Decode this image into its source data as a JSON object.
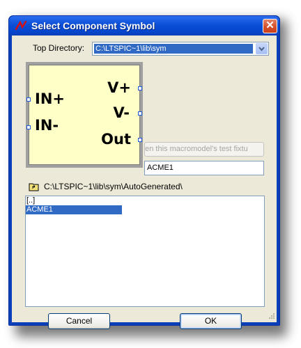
{
  "window": {
    "title": "Select Component Symbol",
    "close_glyph": "✕",
    "colors": {
      "titlebar": "#0a4fd6",
      "client": "#ece9d8",
      "selection": "#316ac5",
      "close": "#d8502a"
    }
  },
  "top_directory": {
    "label": "Top Directory:",
    "value": "C:\\LTSPIC~1\\lib\\sym"
  },
  "preview": {
    "pins": {
      "in_plus": "IN+",
      "in_minus": "IN-",
      "v_plus": "V+",
      "v_minus": "V-",
      "out": "Out"
    },
    "fill_color": "#ffffc8"
  },
  "test_fixture_button": {
    "label": "pen this macromodel's test fixtu"
  },
  "name_field": {
    "value": "ACME1"
  },
  "current_path": "C:\\LTSPIC~1\\lib\\sym\\AutoGenerated\\",
  "list": {
    "items": [
      "[..]",
      "ACME1"
    ],
    "selected_index": 1
  },
  "buttons": {
    "cancel": "Cancel",
    "ok": "OK"
  },
  "icons": [
    "ltspice-app-icon",
    "close-icon",
    "chevron-down-icon",
    "folder-up-icon",
    "resize-grip-icon"
  ]
}
